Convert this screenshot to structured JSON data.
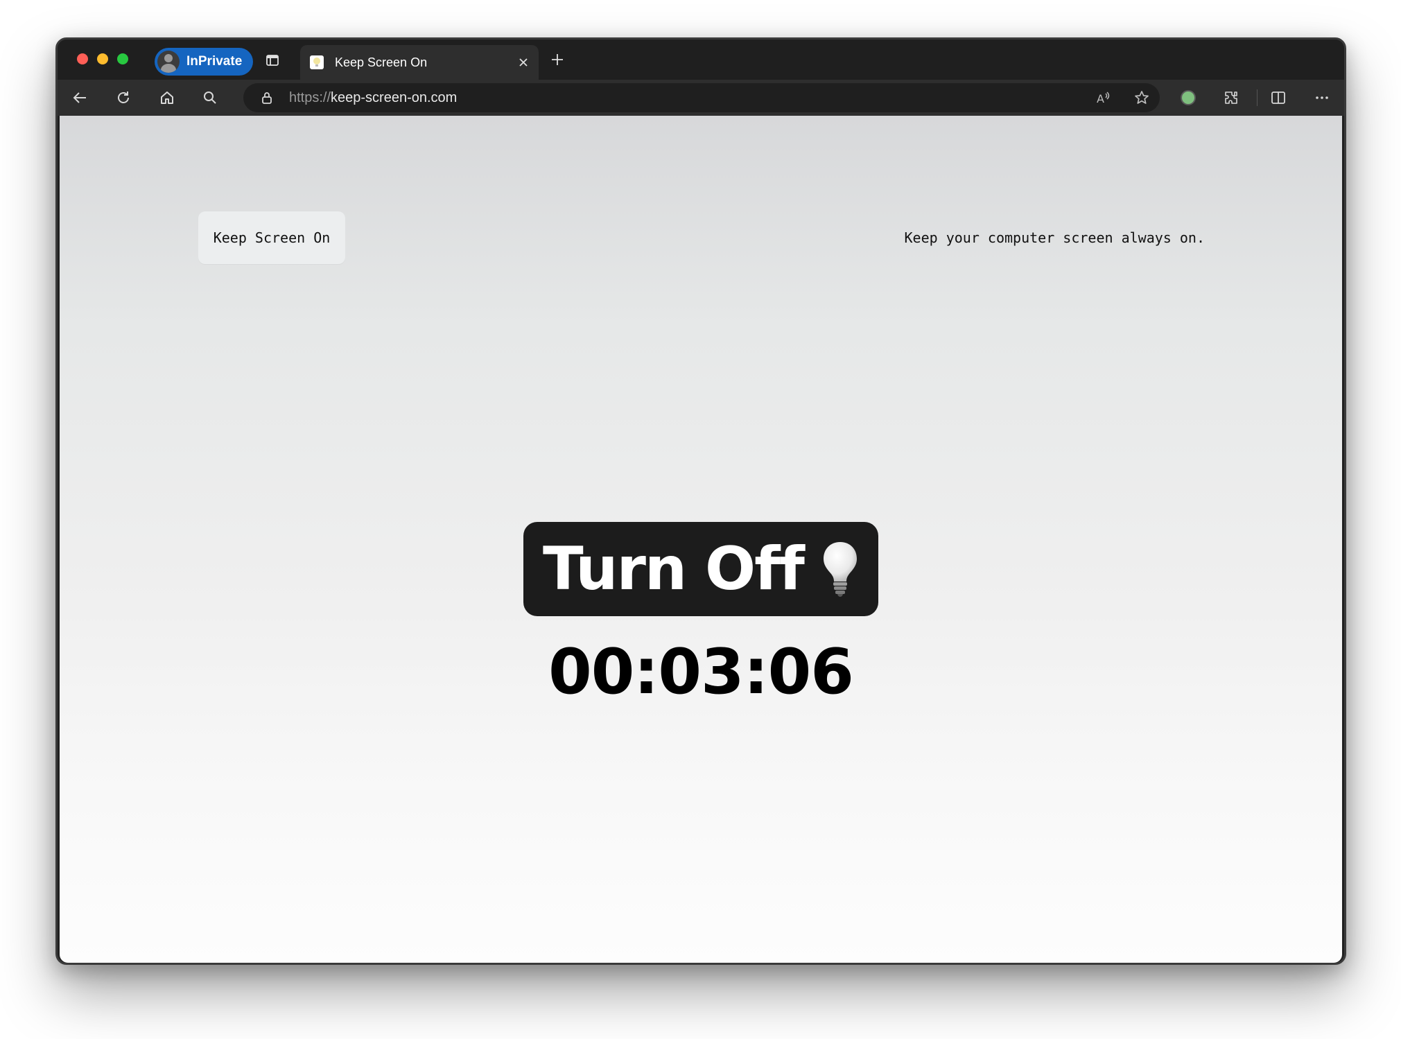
{
  "browser": {
    "profile_label": "InPrivate",
    "tab": {
      "title": "Keep Screen On"
    },
    "address": {
      "scheme": "https://",
      "host": "keep-screen-on.com"
    },
    "profile_color": "#7fc07f",
    "inprivate_color": "#1565c0"
  },
  "page": {
    "brand": "Keep Screen On",
    "tagline": "Keep your computer screen always on.",
    "toggle_button_label": "Turn Off",
    "toggle_icon": "lightbulb-icon",
    "timer": "00:03:06"
  },
  "icons": [
    "tab-actions-icon",
    "close-icon",
    "plus-icon",
    "back-icon",
    "refresh-icon",
    "home-icon",
    "search-icon",
    "lock-icon",
    "read-aloud-icon",
    "favorite-star-icon",
    "extensions-icon",
    "split-screen-icon",
    "more-icon"
  ]
}
